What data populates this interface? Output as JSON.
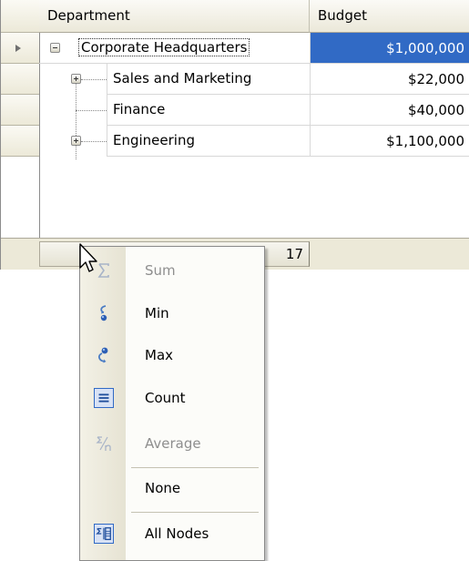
{
  "grid": {
    "columns": {
      "department": "Department",
      "budget": "Budget"
    },
    "rows": [
      {
        "department": "Corporate Headquarters",
        "budget": "$1,000,000",
        "level": 0,
        "expanded": true,
        "selected": true
      },
      {
        "department": "Sales and Marketing",
        "budget": "$22,000",
        "level": 1,
        "expanded": false
      },
      {
        "department": "Finance",
        "budget": "$40,000",
        "level": 1
      },
      {
        "department": "Engineering",
        "budget": "$1,100,000",
        "level": 1,
        "expanded": false
      }
    ],
    "footer_summary": "17",
    "selection_color": "#316ac5"
  },
  "context_menu": {
    "items": [
      {
        "label": "Sum",
        "icon": "sum-icon",
        "enabled": false
      },
      {
        "label": "Min",
        "icon": "min-icon",
        "enabled": true
      },
      {
        "label": "Max",
        "icon": "max-icon",
        "enabled": true
      },
      {
        "label": "Count",
        "icon": "count-icon",
        "enabled": true,
        "checked": true
      },
      {
        "label": "Average",
        "icon": "average-icon",
        "enabled": false
      },
      {
        "label": "None",
        "icon": "",
        "enabled": true
      },
      {
        "label": "All Nodes",
        "icon": "all-nodes-icon",
        "enabled": true,
        "checked": true
      }
    ]
  }
}
